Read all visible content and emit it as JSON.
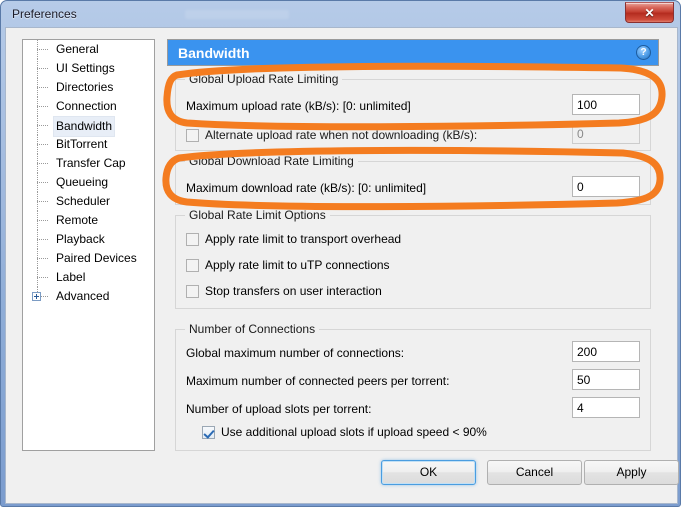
{
  "window": {
    "title": "Preferences",
    "close_label": "✕",
    "close_icon": "close-icon"
  },
  "sidebar": {
    "items": [
      {
        "label": "General",
        "selected": false,
        "expandable": false
      },
      {
        "label": "UI Settings",
        "selected": false,
        "expandable": false
      },
      {
        "label": "Directories",
        "selected": false,
        "expandable": false
      },
      {
        "label": "Connection",
        "selected": false,
        "expandable": false
      },
      {
        "label": "Bandwidth",
        "selected": true,
        "expandable": false
      },
      {
        "label": "BitTorrent",
        "selected": false,
        "expandable": false
      },
      {
        "label": "Transfer Cap",
        "selected": false,
        "expandable": false
      },
      {
        "label": "Queueing",
        "selected": false,
        "expandable": false
      },
      {
        "label": "Scheduler",
        "selected": false,
        "expandable": false
      },
      {
        "label": "Remote",
        "selected": false,
        "expandable": false
      },
      {
        "label": "Playback",
        "selected": false,
        "expandable": false
      },
      {
        "label": "Paired Devices",
        "selected": false,
        "expandable": false
      },
      {
        "label": "Label",
        "selected": false,
        "expandable": false
      },
      {
        "label": "Advanced",
        "selected": false,
        "expandable": true
      }
    ]
  },
  "panel": {
    "title": "Bandwidth",
    "help_label": "?",
    "upload_group": {
      "legend": "Global Upload Rate Limiting",
      "max_rate_label": "Maximum upload rate (kB/s): [0: unlimited]",
      "max_rate_value": "100",
      "alt_rate_label": "Alternate upload rate when not downloading (kB/s):",
      "alt_rate_checked": false,
      "alt_rate_value": "0"
    },
    "download_group": {
      "legend": "Global Download Rate Limiting",
      "max_rate_label": "Maximum download rate (kB/s): [0: unlimited]",
      "max_rate_value": "0"
    },
    "rate_options_group": {
      "legend": "Global Rate Limit Options",
      "options": [
        {
          "label": "Apply rate limit to transport overhead",
          "checked": false
        },
        {
          "label": "Apply rate limit to uTP connections",
          "checked": false
        },
        {
          "label": "Stop transfers on user interaction",
          "checked": false
        }
      ]
    },
    "connections_group": {
      "legend": "Number of Connections",
      "rows": [
        {
          "label": "Global maximum number of connections:",
          "value": "200"
        },
        {
          "label": "Maximum number of connected peers per torrent:",
          "value": "50"
        },
        {
          "label": "Number of upload slots per torrent:",
          "value": "4"
        }
      ],
      "extra_slots_label": "Use additional upload slots if upload speed < 90%",
      "extra_slots_checked": true
    }
  },
  "footer": {
    "ok_label": "OK",
    "cancel_label": "Cancel",
    "apply_label": "Apply"
  },
  "annotations": {
    "accent_color": "#F47C20",
    "highlight_upload": "Global Upload Rate Limiting",
    "highlight_download": "Global Download Rate Limiting"
  }
}
